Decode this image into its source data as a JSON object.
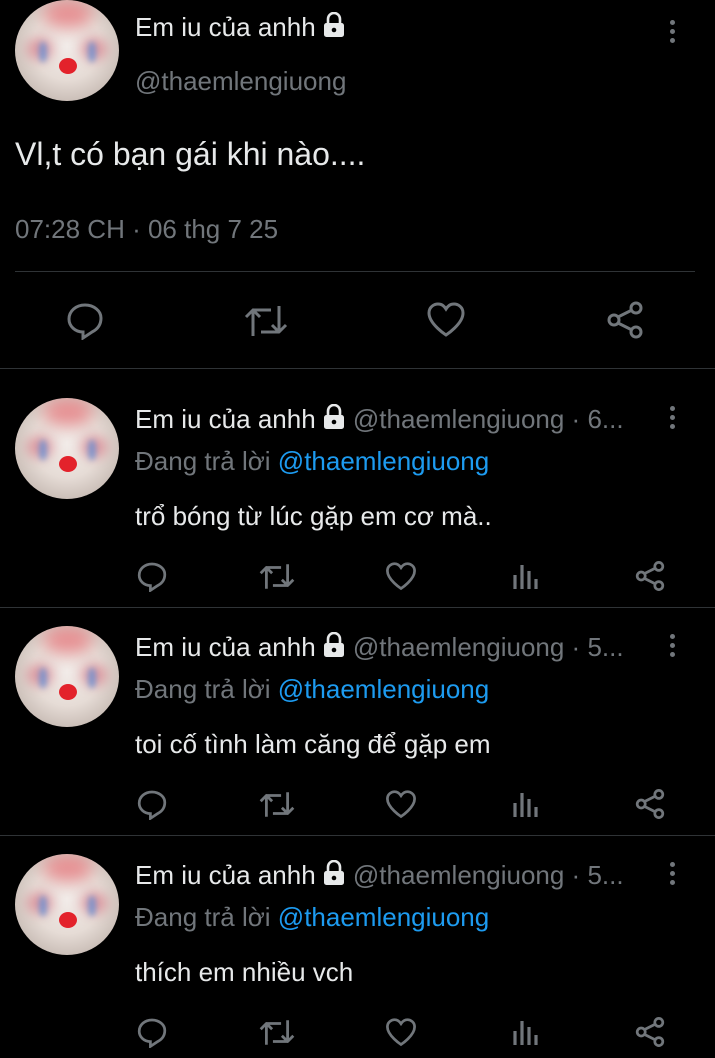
{
  "main_tweet": {
    "display_name": "Em iu của anhh",
    "handle": "@thaemlengiuong",
    "text": "Vl,t có bạn gái khi nào....",
    "timestamp": "07:28 CH · 06 thg 7 25"
  },
  "replies": [
    {
      "display_name": "Em iu của anhh",
      "handle_time": "@thaemlengiuong · 6...",
      "replying_label": "Đang trả lời",
      "replying_to": "@thaemlengiuong",
      "text": "trổ bóng từ lúc gặp em cơ mà.."
    },
    {
      "display_name": "Em iu của anhh",
      "handle_time": "@thaemlengiuong · 5...",
      "replying_label": "Đang trả lời",
      "replying_to": "@thaemlengiuong",
      "text": "toi cố tình làm căng để gặp em"
    },
    {
      "display_name": "Em iu của anhh",
      "handle_time": "@thaemlengiuong · 5...",
      "replying_label": "Đang trả lời",
      "replying_to": "@thaemlengiuong",
      "text": "thích em nhiều vch"
    }
  ],
  "icons": {
    "reply": "reply-icon",
    "retweet": "retweet-icon",
    "like": "heart-icon",
    "views": "views-icon",
    "share": "share-icon",
    "more": "more-options-icon",
    "lock": "lock-icon"
  },
  "colors": {
    "background": "#000000",
    "text": "#e7e9ea",
    "secondary": "#71767b",
    "link": "#1d9bf0",
    "divider": "#2f3336"
  }
}
